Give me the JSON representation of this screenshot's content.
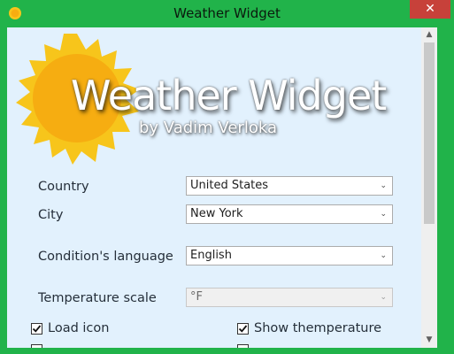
{
  "window": {
    "title": "Weather Widget",
    "close_glyph": "✕",
    "app_icon": "sun-icon"
  },
  "hero": {
    "title": "Weather Widget",
    "byline": "by Vadim Verloka",
    "image": "sun-icon"
  },
  "form": {
    "country": {
      "label": "Country",
      "value": "United States"
    },
    "city": {
      "label": "City",
      "value": "New York"
    },
    "language": {
      "label": "Condition's language",
      "value": "English"
    },
    "temperature_scale": {
      "label": "Temperature scale",
      "value": "°F",
      "disabled": true
    }
  },
  "options": {
    "load_icon": {
      "label": "Load icon",
      "checked": true
    },
    "show_temperature": {
      "label": "Show themperature",
      "checked": true
    }
  },
  "scrollbar": {
    "up_glyph": "▲",
    "down_glyph": "▼"
  },
  "colors": {
    "frame": "#21b34a",
    "close_button": "#c7413a",
    "client_background": "#e2f1fd",
    "sun_outer": "#f7c51b",
    "sun_inner": "#f6ad11"
  }
}
